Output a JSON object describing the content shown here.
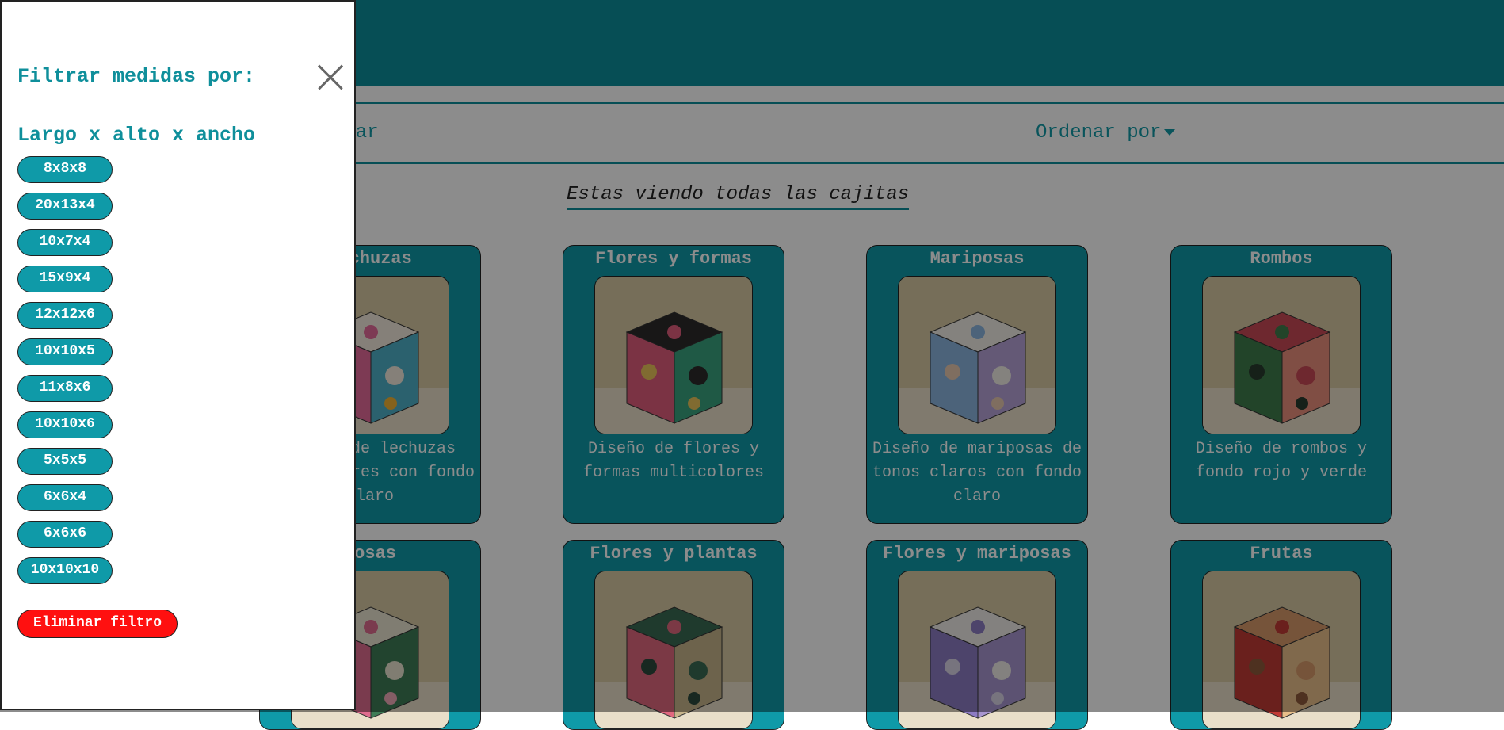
{
  "toolbar": {
    "filter_label": "trar",
    "sort_label": "Ordenar por"
  },
  "viewing_label": "Estas viendo todas las cajitas",
  "cards": [
    {
      "title": "Lechuzas",
      "description": "Diseño de lechuzas multicolores con fondo claro",
      "colors": [
        "#f3e9dc",
        "#e36b9a",
        "#4fb1c9",
        "#f2b233"
      ]
    },
    {
      "title": "Flores y formas",
      "description": "Diseño de flores y formas multicolores",
      "colors": [
        "#2c2a2a",
        "#e05d7d",
        "#39a37e",
        "#e9c35a"
      ]
    },
    {
      "title": "Mariposas",
      "description": "Diseño de mariposas de tonos claros con fondo claro",
      "colors": [
        "#f1ede5",
        "#8ab4df",
        "#b7a3d8",
        "#e7c9b0"
      ]
    },
    {
      "title": "Rombos",
      "description": "Diseño de rombos y fondo rojo y verde",
      "colors": [
        "#c94a57",
        "#3e7d4c",
        "#e98f7c",
        "#283b2e"
      ]
    },
    {
      "title": "Rosas",
      "description": "",
      "colors": [
        "#e9e3d0",
        "#de6c8e",
        "#3f7d56",
        "#f0a9b9"
      ]
    },
    {
      "title": "Flores y plantas",
      "description": "",
      "colors": [
        "#3a6b52",
        "#e1687f",
        "#c7b58b",
        "#2d4a3d"
      ]
    },
    {
      "title": "Flores y mariposas",
      "description": "",
      "colors": [
        "#efece7",
        "#8d7cc4",
        "#a896cf",
        "#d9d3e6"
      ]
    },
    {
      "title": "Frutas",
      "description": "",
      "colors": [
        "#d89a6b",
        "#c23b35",
        "#e9c08a",
        "#8e5a3b"
      ]
    }
  ],
  "panel": {
    "title": "Filtrar medidas por:",
    "group_title": "Largo x alto x ancho",
    "sizes": [
      "8x8x8",
      "20x13x4",
      "10x7x4",
      "15x9x4",
      "12x12x6",
      "10x10x5",
      "11x8x6",
      "10x10x6",
      "5x5x5",
      "6x6x4",
      "6x6x6",
      "10x10x10"
    ],
    "remove_label": "Eliminar filtro"
  }
}
